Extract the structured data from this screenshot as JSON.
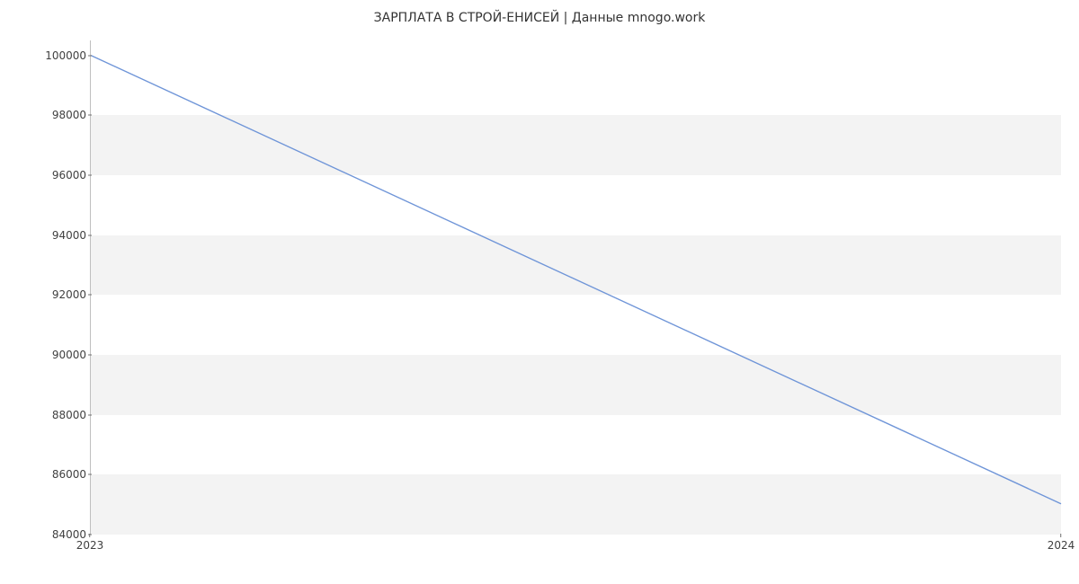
{
  "chart_data": {
    "type": "line",
    "title": "ЗАРПЛАТА В СТРОЙ-ЕНИСЕЙ | Данные mnogo.work",
    "xlabel": "",
    "ylabel": "",
    "x": [
      2023,
      2024
    ],
    "values": [
      100000,
      85000
    ],
    "x_ticks": [
      2023,
      2024
    ],
    "y_ticks": [
      84000,
      86000,
      88000,
      90000,
      92000,
      94000,
      96000,
      98000,
      100000
    ],
    "xlim": [
      2023,
      2024
    ],
    "ylim": [
      84000,
      100500
    ],
    "line_color": "#6f95d8",
    "grid": "horizontal-bands"
  }
}
